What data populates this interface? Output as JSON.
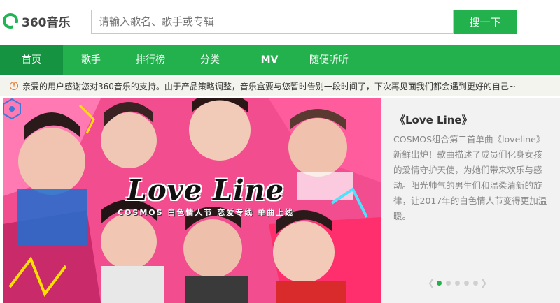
{
  "header": {
    "logo_text": "360音乐",
    "search_placeholder": "请输入歌名、歌手或专辑",
    "search_button": "搜一下"
  },
  "nav": {
    "items": [
      {
        "label": "首页",
        "active": true
      },
      {
        "label": "歌手",
        "active": false
      },
      {
        "label": "排行榜",
        "active": false
      },
      {
        "label": "分类",
        "active": false
      },
      {
        "label": "MV",
        "active": false
      },
      {
        "label": "随便听听",
        "active": false
      }
    ]
  },
  "notice": {
    "icon": "warning-circle-icon",
    "text": "亲爱的用户感谢您对360音乐的支持。由于产品策略调整，音乐盒要与您暂时告别一段时间了，下次再见面我们都会遇到更好的自己~"
  },
  "banner": {
    "promo_title": "Love Line",
    "promo_subtitle": "COSMOS 白色情人节 恋爱专线 单曲上线",
    "badge_text": "COSMOS",
    "song_title": "《Love Line》",
    "song_desc": "COSMOS组合第二首单曲《loveline》新鲜出炉！歌曲描述了成员们化身女孩的爱情守护天使，为她们带来欢乐与感动。阳光帅气的男生们和温柔清新的旋律，让2017年的白色情人节变得更加温暖。",
    "slide_count": 5,
    "active_slide": 1
  },
  "colors": {
    "brand_green": "#22b14c",
    "nav_active": "#159340",
    "notice_bg": "#f4f4ef"
  }
}
